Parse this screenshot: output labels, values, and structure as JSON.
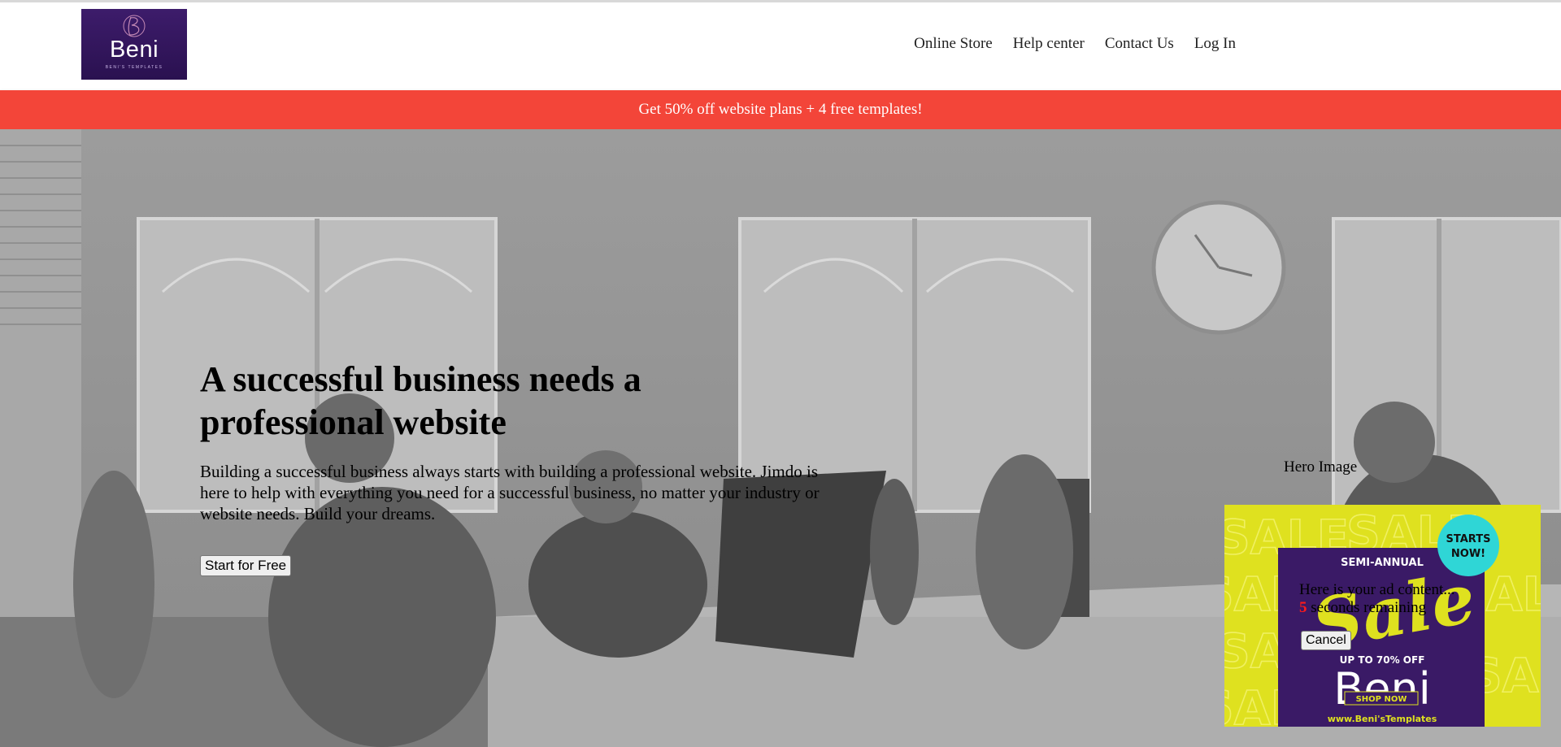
{
  "brand": {
    "name": "Beni",
    "subtitle": "BENI'S TEMPLATES",
    "color": "#3d1c6b"
  },
  "nav": {
    "items": [
      {
        "label": "Online Store"
      },
      {
        "label": "Help center"
      },
      {
        "label": "Contact Us"
      },
      {
        "label": "Log In"
      }
    ]
  },
  "promo": {
    "text": "Get 50% off website plans + 4 free templates!",
    "color": "#f34539"
  },
  "hero": {
    "title": "A successful business needs a professional website",
    "description": "Building a successful business always starts with building a professional website. Jimdo is here to help with everything you need for a successful business, no matter your industry or website needs. Build your dreams.",
    "cta_label": "Start for Free",
    "image_alt": "Hero Image"
  },
  "ad": {
    "badge": "STARTS NOW!",
    "label": "SEMI-ANNUAL",
    "headline": "Sale",
    "offer": "UP TO 70% OFF",
    "brand": "Beni",
    "button": "SHOP NOW",
    "url": "www.Beni'sTemplates",
    "background_word": "SALE",
    "content_text": "Here is your ad content...",
    "countdown_value": "5",
    "countdown_text": "seconds remaining",
    "cancel_label": "Cancel",
    "bg_color": "#dfe11f",
    "badge_color": "#2fd6d6",
    "panel_color": "#3a1a66"
  }
}
